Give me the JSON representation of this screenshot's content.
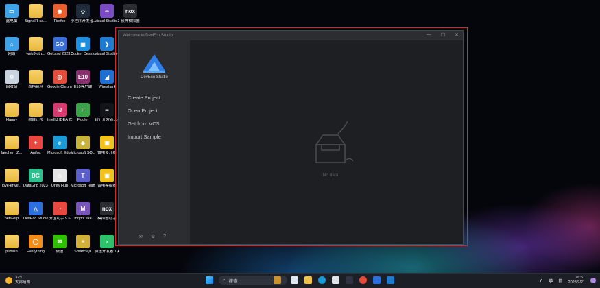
{
  "desktop": {
    "icons": [
      {
        "label": "此电脑",
        "color": "#3ea2e8",
        "glyph": "▭",
        "kind": "pc"
      },
      {
        "label": "SignalR-sa...",
        "color": "#f0c24b",
        "glyph": "",
        "kind": "folder"
      },
      {
        "label": "Firefox",
        "color": "#e8602c",
        "glyph": "◉",
        "kind": "app"
      },
      {
        "label": "小程序开发者工具",
        "color": "#1f2a3a",
        "glyph": "◇",
        "kind": "app"
      },
      {
        "label": "Visual Studio 20...",
        "color": "#7b4bc4",
        "glyph": "∞",
        "kind": "app"
      },
      {
        "label": "夜神模拟器",
        "color": "#2b2d33",
        "glyph": "nox",
        "kind": "app"
      },
      {
        "label": "网络",
        "color": "#3ea2e8",
        "glyph": "⌂",
        "kind": "app"
      },
      {
        "label": "web3-dth...",
        "color": "#f0c24b",
        "glyph": "",
        "kind": "folder"
      },
      {
        "label": "GoLand 2023.2",
        "color": "#3b6fd8",
        "glyph": "GO",
        "kind": "app"
      },
      {
        "label": "Docker Desktop",
        "color": "#1d8fe0",
        "glyph": "▦",
        "kind": "app"
      },
      {
        "label": "Visual Studio Code",
        "color": "#1f7bd0",
        "glyph": "❯",
        "kind": "app"
      },
      {
        "label": "回收站",
        "color": "#c8d3de",
        "glyph": "♲",
        "kind": "app"
      },
      {
        "label": "表格资料",
        "color": "#f0c24b",
        "glyph": "",
        "kind": "folder"
      },
      {
        "label": "Google Chrome",
        "color": "#e24d3b",
        "glyph": "◎",
        "kind": "app"
      },
      {
        "label": "E10客户端",
        "color": "#8a2f6e",
        "glyph": "E10",
        "kind": "app"
      },
      {
        "label": "Wireshark",
        "color": "#1e6fd0",
        "glyph": "◢",
        "kind": "app"
      },
      {
        "label": "Happy",
        "color": "#f0c24b",
        "glyph": "",
        "kind": "folder"
      },
      {
        "label": "项目迁移",
        "color": "#f0c24b",
        "glyph": "",
        "kind": "folder"
      },
      {
        "label": "IntelliJ IDEA 2023.2",
        "color": "#d73a6f",
        "glyph": "IJ",
        "kind": "app"
      },
      {
        "label": "Fiddler",
        "color": "#3aa34a",
        "glyph": "F",
        "kind": "app"
      },
      {
        "label": "钉钉开发者工具",
        "color": "#111418",
        "glyph": "∞",
        "kind": "app"
      },
      {
        "label": "laochen_Z...",
        "color": "#f0c24b",
        "glyph": "",
        "kind": "folder"
      },
      {
        "label": "Apifox",
        "color": "#e8483f",
        "glyph": "✦",
        "kind": "app"
      },
      {
        "label": "Microsoft Edge",
        "color": "#1a9ad6",
        "glyph": "e",
        "kind": "app"
      },
      {
        "label": "Microsoft SQL Serve...",
        "color": "#c9b23b",
        "glyph": "◆",
        "kind": "app"
      },
      {
        "label": "雷电多开器",
        "color": "#f2c21c",
        "glyph": "▣",
        "kind": "app"
      },
      {
        "label": "love-enve...",
        "color": "#f0c24b",
        "glyph": "",
        "kind": "folder"
      },
      {
        "label": "DataGrip 2023.2",
        "color": "#2fbf8e",
        "glyph": "DG",
        "kind": "app"
      },
      {
        "label": "Unity Hub",
        "color": "#e6e6e6",
        "glyph": "◇",
        "kind": "app"
      },
      {
        "label": "Microsoft Teams (...",
        "color": "#5b5fc7",
        "glyph": "T",
        "kind": "app"
      },
      {
        "label": "雷电模拟器",
        "color": "#f2c21c",
        "glyph": "▣",
        "kind": "app"
      },
      {
        "label": "net6-erp",
        "color": "#f0c24b",
        "glyph": "",
        "kind": "folder"
      },
      {
        "label": "DevEco Studio",
        "color": "#2b6fe0",
        "glyph": "△",
        "kind": "app"
      },
      {
        "label": "分区助手 9.6",
        "color": "#e8483f",
        "glyph": "◔",
        "kind": "app"
      },
      {
        "label": "mqttfx.exe",
        "color": "#7a55b8",
        "glyph": "M",
        "kind": "app"
      },
      {
        "label": "模拟器助手",
        "color": "#2b2d33",
        "glyph": "nox",
        "kind": "app"
      },
      {
        "label": "publish",
        "color": "#f0c24b",
        "glyph": "",
        "kind": "folder"
      },
      {
        "label": "Everything",
        "color": "#f28c1a",
        "glyph": "◯",
        "kind": "app"
      },
      {
        "label": "微信",
        "color": "#2ec100",
        "glyph": "✉",
        "kind": "app"
      },
      {
        "label": "SmartSQL",
        "color": "#d2b03a",
        "glyph": "≡",
        "kind": "app"
      },
      {
        "label": "微信开发者工具",
        "color": "#2ec16a",
        "glyph": "›",
        "kind": "app"
      }
    ]
  },
  "window": {
    "title": "Welcome to DevEco Studio",
    "controls": {
      "minimize": "—",
      "maximize": "☐",
      "close": "✕"
    },
    "app_name": "DevEco Studio",
    "menu": [
      "Create Project",
      "Open Project",
      "Get from VCS",
      "Import Sample"
    ],
    "bottom_icons": [
      "mail-icon",
      "gear-icon",
      "help-icon"
    ],
    "bottom_glyphs": {
      "mail": "✉",
      "gear": "⚙",
      "help": "?"
    },
    "empty_label": "No data"
  },
  "taskbar": {
    "weather_temp": "32°C",
    "weather_desc": "大部晴朗",
    "search_placeholder": "搜索",
    "tray_lang": "英",
    "time": "16:51",
    "date": "2023/9/21",
    "chevron": "∧"
  }
}
